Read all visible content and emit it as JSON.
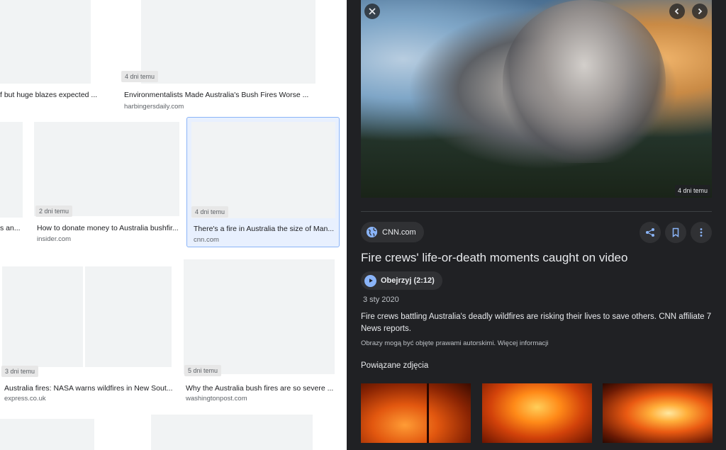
{
  "results": [
    {
      "title": "f but huge blazes expected ...",
      "site": "",
      "badge": "",
      "image": "fire"
    },
    {
      "title": "Environmentalists Made Australia's Bush Fires Worse ...",
      "site": "harbingersdaily.com",
      "badge": "4 dni temu",
      "image": "fire"
    },
    {
      "title": "s an...",
      "site": "",
      "badge": "",
      "image": "fire"
    },
    {
      "title": "How to donate money to Australia bushfir...",
      "site": "insider.com",
      "badge": "2 dni temu",
      "image": "fire"
    },
    {
      "title": "There's a fire in Australia the size of Man...",
      "site": "cnn.com",
      "badge": "4 dni temu",
      "image": "smoke"
    },
    {
      "title": "Australia fires: NASA warns wildfires in New Sout...",
      "site": "express.co.uk",
      "badge": "3 dni temu",
      "image": "nasa"
    },
    {
      "title": "Why the Australia bush fires are so severe ...",
      "site": "washingtonpost.com",
      "badge": "5 dni temu",
      "image": "fire"
    }
  ],
  "detail": {
    "image_badge": "4 dni temu",
    "source": "CNN.com",
    "title": "Fire crews' life-or-death moments caught on video",
    "watch_label": "Obejrzyj (2:12)",
    "date": "3 sty 2020",
    "description": "Fire crews battling Australia's deadly wildfires are risking their lives to save others. CNN affiliate 7 News reports.",
    "copyright_text": "Obrazy mogą być objęte prawami autorskimi.",
    "more_info": "Więcej informacji",
    "related_heading": "Powiązane zdjęcia"
  },
  "colors": {
    "panel_bg": "#202124",
    "chip_bg": "#303134",
    "accent": "#8ab4f8",
    "selected_border": "#8ab4f8",
    "selected_bg": "#e8f0fe"
  },
  "icons": [
    "close-icon",
    "chevron-left-icon",
    "chevron-right-icon",
    "globe-icon",
    "share-icon",
    "bookmark-icon",
    "more-vert-icon",
    "play-icon"
  ]
}
